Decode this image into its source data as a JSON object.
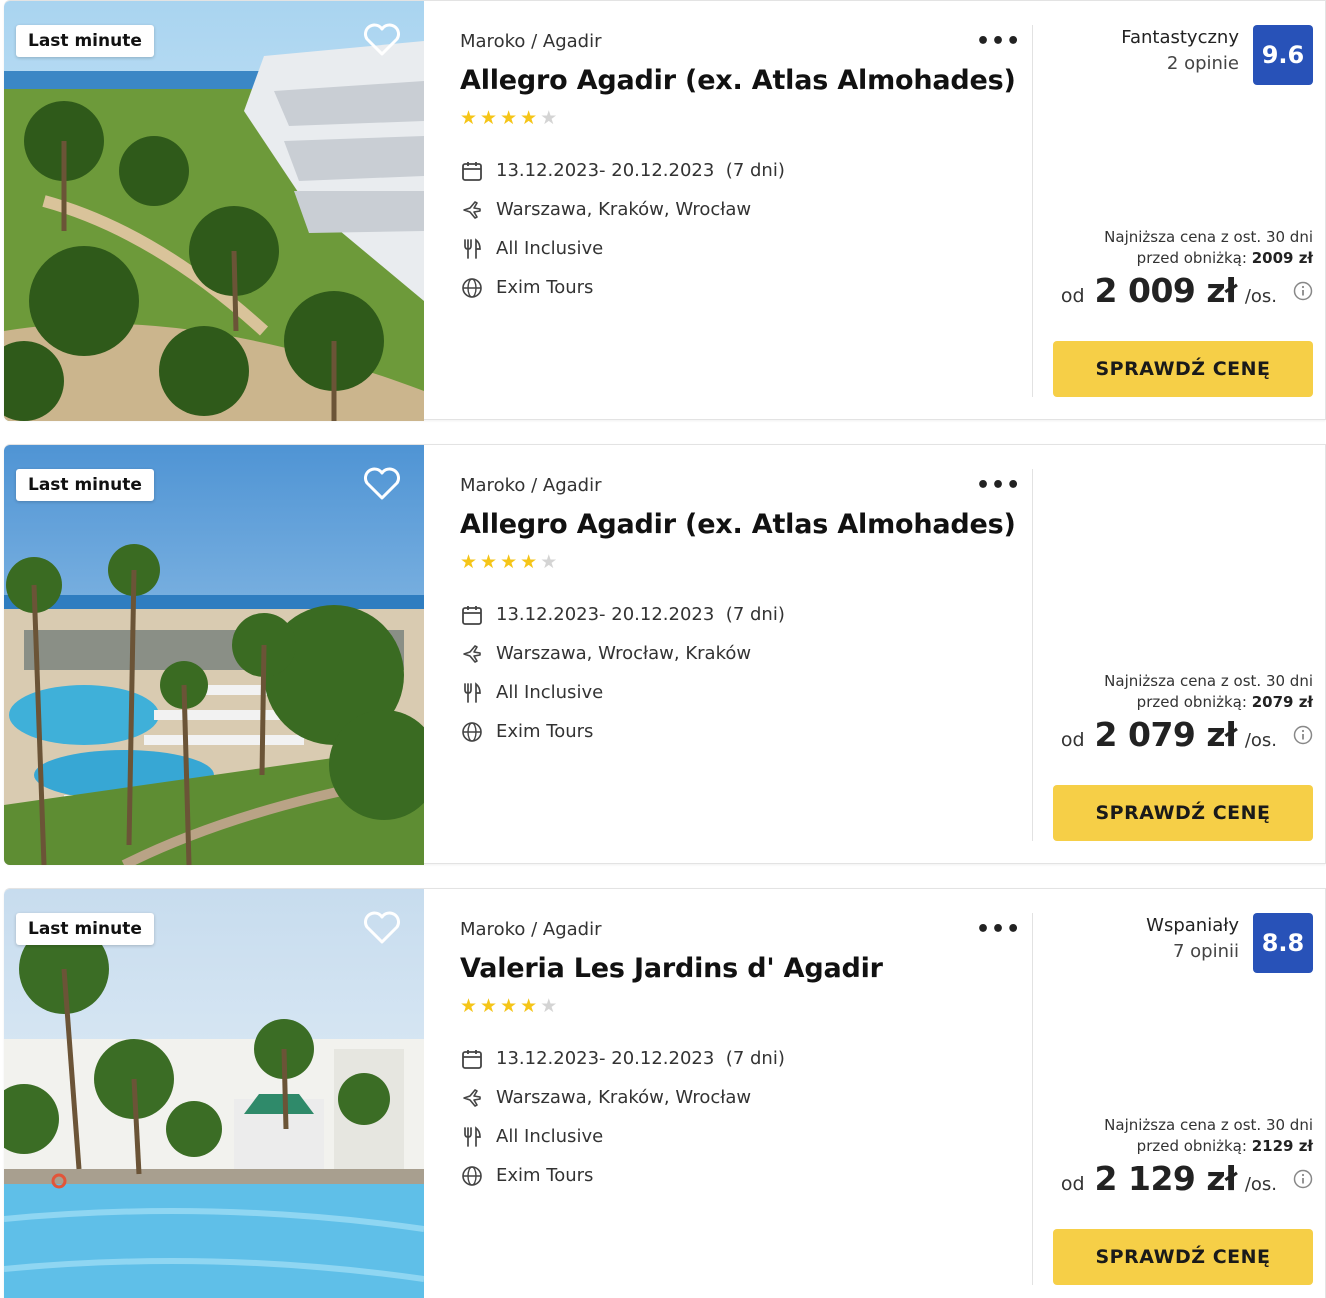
{
  "listings": [
    {
      "badge": "Last minute",
      "location": "Maroko / Agadir",
      "more": "•••",
      "name": "Allegro Agadir (ex. Atlas Almohades)",
      "stars": 4,
      "dates": "13.12.2023- 20.12.2023",
      "duration": "(7 dni)",
      "departures": "Warszawa, Kraków, Wrocław",
      "board": "All Inclusive",
      "operator": "Exim Tours",
      "rating_label": "Fantastyczny",
      "rating_count": "2 opinie",
      "rating_score": "9.6",
      "lowest_line1": "Najniższa cena z ost. 30 dni",
      "lowest_line2": "przed obniżką:",
      "lowest_value": "2009 zł",
      "price_prefix": "od",
      "price": "2 009 zł",
      "price_suffix": "/os.",
      "cta": "SPRAWDŹ CENĘ"
    },
    {
      "badge": "Last minute",
      "location": "Maroko / Agadir",
      "more": "•••",
      "name": "Allegro Agadir (ex. Atlas Almohades)",
      "stars": 4,
      "dates": "13.12.2023- 20.12.2023",
      "duration": "(7 dni)",
      "departures": "Warszawa, Wrocław, Kraków",
      "board": "All Inclusive",
      "operator": "Exim Tours",
      "rating_label": "",
      "rating_count": "",
      "rating_score": "",
      "lowest_line1": "Najniższa cena z ost. 30 dni",
      "lowest_line2": "przed obniżką:",
      "lowest_value": "2079 zł",
      "price_prefix": "od",
      "price": "2 079 zł",
      "price_suffix": "/os.",
      "cta": "SPRAWDŹ CENĘ"
    },
    {
      "badge": "Last minute",
      "location": "Maroko / Agadir",
      "more": "•••",
      "name": "Valeria Les Jardins d' Agadir",
      "stars": 4,
      "dates": "13.12.2023- 20.12.2023",
      "duration": "(7 dni)",
      "departures": "Warszawa, Kraków, Wrocław",
      "board": "All Inclusive",
      "operator": "Exim Tours",
      "rating_label": "Wspaniały",
      "rating_count": "7 opinii",
      "rating_score": "8.8",
      "lowest_line1": "Najniższa cena z ost. 30 dni",
      "lowest_line2": "przed obniżką:",
      "lowest_value": "2129 zł",
      "price_prefix": "od",
      "price": "2 129 zł",
      "price_suffix": "/os.",
      "cta": "SPRAWDŹ CENĘ"
    }
  ],
  "icons": {
    "favorite": "heart-outline-icon",
    "dates": "calendar-icon",
    "departures": "plane-icon",
    "board": "cutlery-icon",
    "operator": "globe-icon",
    "price_info": "info-icon"
  },
  "colors": {
    "cta": "#f6cf47",
    "rating_badge": "#2852b8",
    "star_on": "#f5c518",
    "star_off": "#d4d4d4"
  }
}
